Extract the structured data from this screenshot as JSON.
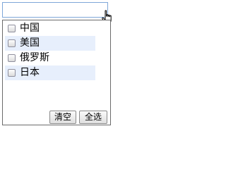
{
  "input": {
    "value": "",
    "placeholder": ""
  },
  "options": [
    {
      "label": "中国",
      "checked": false
    },
    {
      "label": "美国",
      "checked": false
    },
    {
      "label": "俄罗斯",
      "checked": false
    },
    {
      "label": "日本",
      "checked": false
    }
  ],
  "buttons": {
    "clear_label": "清空",
    "select_all_label": "全选"
  },
  "icons": {
    "cursor": "hand-pointer-icon",
    "checkbox": "checkbox-unchecked-icon"
  },
  "colors": {
    "input_border": "#7ea7d8",
    "row_highlight": "#e7effc",
    "dropdown_border": "#6b6b6b"
  }
}
